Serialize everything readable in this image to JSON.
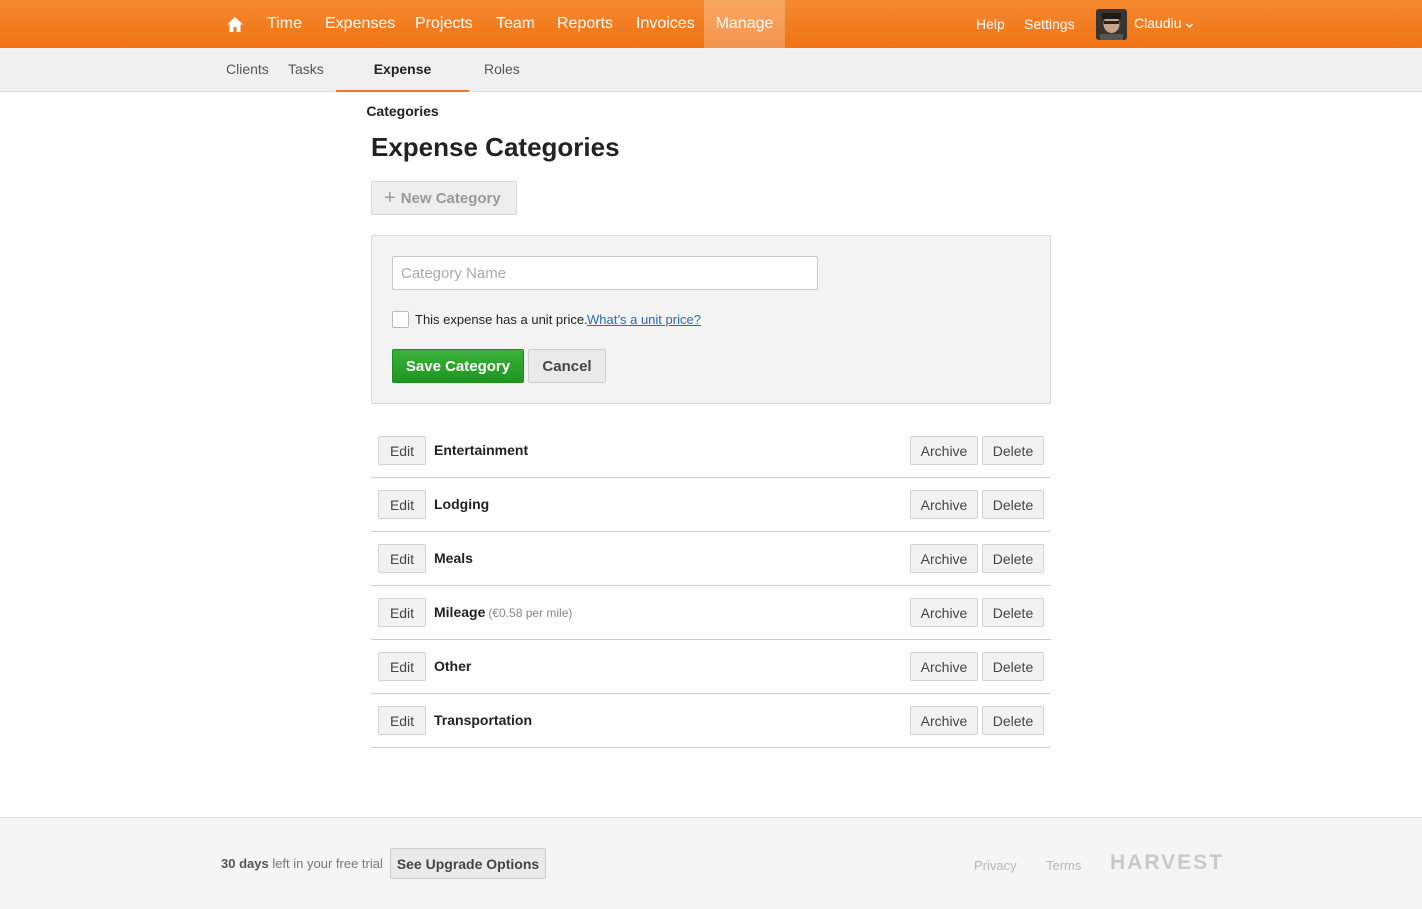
{
  "topnav": {
    "items": [
      {
        "label": "Time"
      },
      {
        "label": "Expenses"
      },
      {
        "label": "Projects"
      },
      {
        "label": "Team"
      },
      {
        "label": "Reports"
      },
      {
        "label": "Invoices"
      },
      {
        "label": "Manage",
        "active": true
      }
    ],
    "help": "Help",
    "settings": "Settings",
    "user": "Claudiu",
    "home_icon": "home-icon",
    "accent": "#f07213"
  },
  "subnav": {
    "items": [
      {
        "label": "Clients"
      },
      {
        "label": "Tasks"
      },
      {
        "label": "Expense Categories",
        "active": true
      },
      {
        "label": "Roles"
      }
    ]
  },
  "main": {
    "title": "Expense Categories",
    "new_category": "New Category",
    "form": {
      "name_placeholder": "Category Name",
      "name_value": "",
      "unit_price_label": "This expense has a unit price.",
      "unit_price_link": "What’s a unit price?",
      "unit_price_checked": false,
      "save": "Save Category",
      "cancel": "Cancel"
    },
    "categories": [
      {
        "name": "Entertainment",
        "note": ""
      },
      {
        "name": "Lodging",
        "note": ""
      },
      {
        "name": "Meals",
        "note": ""
      },
      {
        "name": "Mileage",
        "note": "(€0.58 per mile)"
      },
      {
        "name": "Other",
        "note": ""
      },
      {
        "name": "Transportation",
        "note": ""
      }
    ],
    "edit_label": "Edit",
    "archive_label": "Archive",
    "delete_label": "Delete"
  },
  "footer": {
    "trial_days": "30 days",
    "trial_rest": "left in your free trial",
    "upgrade": "See Upgrade Options",
    "privacy": "Privacy",
    "terms": "Terms",
    "logo": "HARVEST"
  }
}
